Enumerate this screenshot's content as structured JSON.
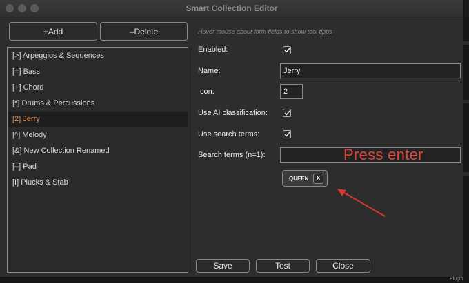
{
  "window": {
    "title": "Smart Collection Editor"
  },
  "toolbar": {
    "add_label": "+Add",
    "delete_label": "–Delete"
  },
  "hint": "Hover mouse about form fields to show tool tipps",
  "collections": [
    {
      "label": "[>] Arpeggios & Sequences",
      "selected": false
    },
    {
      "label": "[=] Bass",
      "selected": false
    },
    {
      "label": "[+] Chord",
      "selected": false
    },
    {
      "label": "[*] Drums & Percussions",
      "selected": false
    },
    {
      "label": "[2] Jerry",
      "selected": true
    },
    {
      "label": "[^] Melody",
      "selected": false
    },
    {
      "label": "[&] New Collection Renamed",
      "selected": false
    },
    {
      "label": "[–] Pad",
      "selected": false
    },
    {
      "label": "[I] Plucks & Stab",
      "selected": false
    }
  ],
  "form": {
    "enabled": {
      "label": "Enabled:",
      "checked": true
    },
    "name": {
      "label": "Name:",
      "value": "Jerry"
    },
    "icon": {
      "label": "Icon:",
      "value": "2"
    },
    "ai": {
      "label": "Use AI classification:",
      "checked": true
    },
    "use_search": {
      "label": "Use search terms:",
      "checked": true
    },
    "search": {
      "label": "Search terms (n=1):",
      "value": ""
    },
    "chip": {
      "label": "QUEEN",
      "remove": "x"
    }
  },
  "annotation": {
    "text": "Press enter",
    "color": "#e0463c"
  },
  "actions": {
    "save": "Save",
    "test": "Test",
    "close": "Close"
  },
  "background": {
    "plugin_label": "Plugin"
  },
  "colors": {
    "selected_item": "#e6965a",
    "window_bg": "#2d2d2d"
  },
  "icons": {
    "checkbox": "check-icon",
    "arrow": "red-arrow-icon"
  }
}
